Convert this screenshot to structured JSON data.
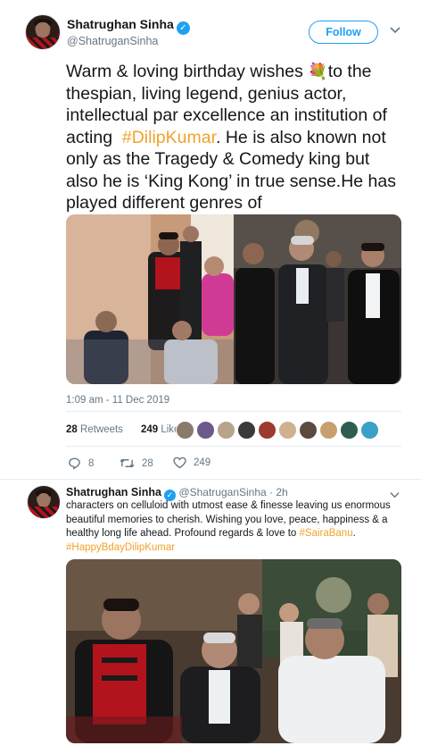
{
  "tweet1": {
    "author_name": "Shatrughan Sinha",
    "author_handle": "@ShatruganSinha",
    "follow_label": "Follow",
    "text_before": "Warm & loving birthday wishes ",
    "flower_emoji": "💐",
    "text_middle": "to the thespian, living legend, genius actor, intellectual par excellence an institution of acting  ",
    "hashtag": "#DilipKumar",
    "text_after": ". He is also known not only as the Tragedy & Comedy king but also he is ‘King Kong’ in true sense.He has played different genres of",
    "timestamp": "1:09 am - 11 Dec 2019",
    "retweets_count": "28",
    "retweets_label": "Retweets",
    "likes_count": "249",
    "likes_label": "Likes",
    "reply_count": "8",
    "retweet_action_count": "28",
    "like_action_count": "249"
  },
  "tweet2": {
    "author_name": "Shatrughan Sinha",
    "author_handle": "@ShatruganSinha",
    "time_ago": "2h",
    "text_before": "characters on celluloid with utmost ease & finesse leaving us enormous beautiful memories to cherish. Wishing you love, peace, happiness & a healthy long life ahead. Profound regards & love to ",
    "mention_tag": "#SairaBanu",
    "text_after": ".",
    "hashtag": "#HappyBdayDilipKumar"
  },
  "colors": {
    "accent": "#1da1f2",
    "hashtag": "#f2a22c",
    "muted": "#657786"
  }
}
